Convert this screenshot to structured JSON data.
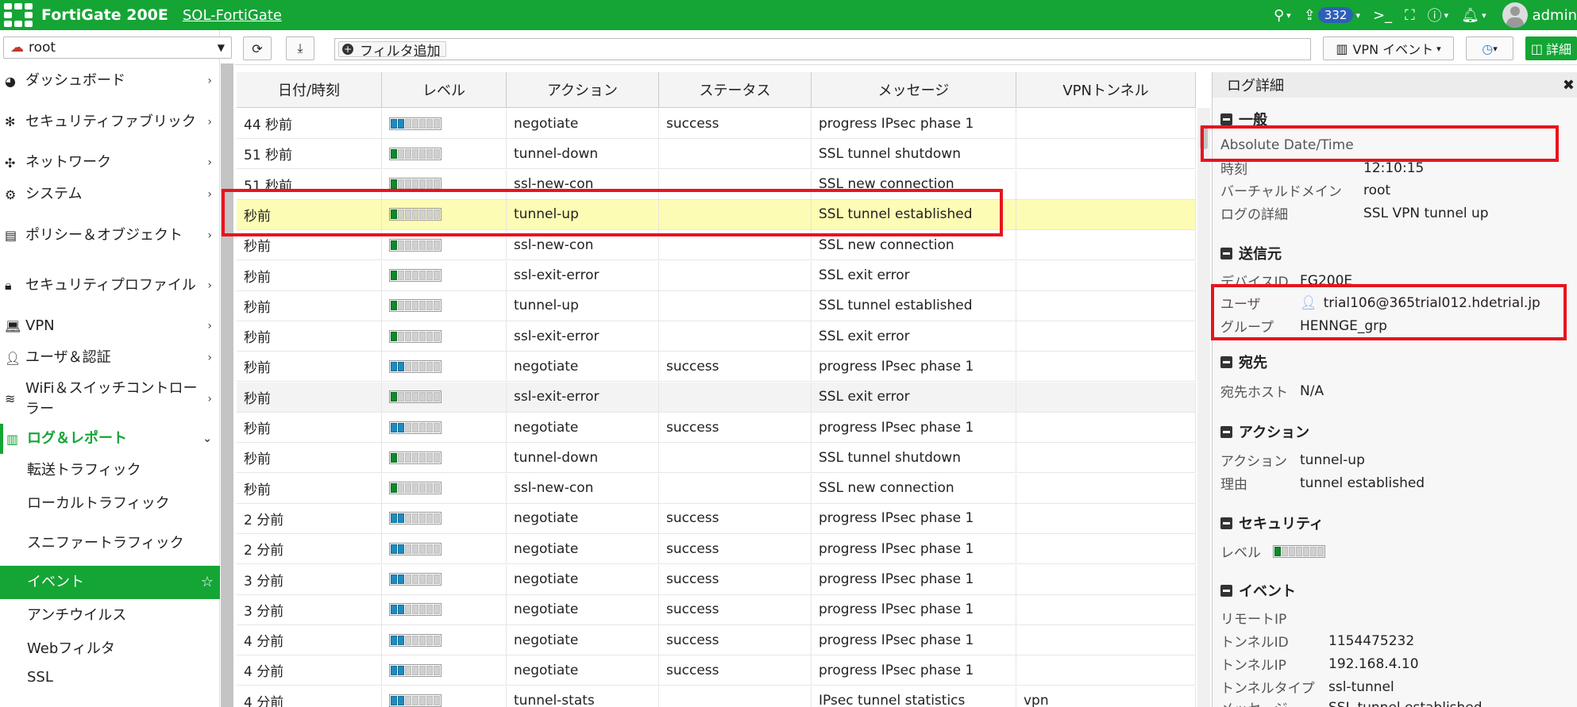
{
  "topbar": {
    "product": "FortiGate 200E",
    "hostname": "SOL-FortiGate",
    "notifications": "332",
    "username": "admin",
    "icons": [
      "search-icon",
      "upload-icon",
      "cli-icon",
      "fullscreen-icon",
      "help-icon",
      "bell-icon",
      "user-icon"
    ]
  },
  "sidebar": {
    "vdom": "root",
    "menu": [
      {
        "icon": "dashboard-icon",
        "label": "ダッシュボード",
        "h": 40
      },
      {
        "icon": "fabric-icon",
        "label": "セキュリティファブリック",
        "h": 63
      },
      {
        "icon": "network-icon",
        "label": "ネットワーク",
        "h": 40
      },
      {
        "icon": "gear-icon",
        "label": "システム",
        "h": 40
      },
      {
        "icon": "policy-icon",
        "label": "ポリシー＆オブジェクト",
        "h": 63
      },
      {
        "icon": "lock-icon",
        "label": "セキュリティプロファイル",
        "h": 63
      },
      {
        "icon": "laptop-icon",
        "label": "VPN",
        "h": 40
      },
      {
        "icon": "user-icon",
        "label": "ユーザ＆認証",
        "h": 40
      },
      {
        "icon": "wifi-icon",
        "label": "WiFi＆スイッチコントローラー",
        "h": 63
      }
    ],
    "active_section": {
      "icon": "chart-icon",
      "label": "ログ＆レポート"
    },
    "submenu": [
      "転送トラフィック",
      "ローカルトラフィック",
      "スニファートラフィック",
      "イベント",
      "アンチウイルス",
      "Webフィルタ",
      "SSL"
    ]
  },
  "toolbar": {
    "filter_label": "フィルタ追加",
    "vpn_events": "VPN イベント",
    "details": "詳細"
  },
  "grid": {
    "columns": [
      "日付/時刻",
      "レベル",
      "アクション",
      "ステータス",
      "メッセージ",
      "VPNトンネル"
    ],
    "rows": [
      {
        "time": "44 秒前",
        "level": "blue2",
        "action": "negotiate",
        "status": "success",
        "message": "progress IPsec phase 1",
        "vpn": ""
      },
      {
        "time": "51 秒前",
        "level": "green1",
        "action": "tunnel-down",
        "status": "",
        "message": "SSL tunnel shutdown",
        "vpn": ""
      },
      {
        "time": "51 秒前",
        "level": "green1",
        "action": "ssl-new-con",
        "status": "",
        "message": "SSL new connection",
        "vpn": ""
      },
      {
        "time": "秒前",
        "level": "green1",
        "action": "tunnel-up",
        "status": "",
        "message": "SSL tunnel established",
        "vpn": ""
      },
      {
        "time": "秒前",
        "level": "green1",
        "action": "ssl-new-con",
        "status": "",
        "message": "SSL new connection",
        "vpn": ""
      },
      {
        "time": "秒前",
        "level": "green1",
        "action": "ssl-exit-error",
        "status": "",
        "message": "SSL exit error",
        "vpn": ""
      },
      {
        "time": "秒前",
        "level": "green1",
        "action": "tunnel-up",
        "status": "",
        "message": "SSL tunnel established",
        "vpn": ""
      },
      {
        "time": "秒前",
        "level": "green1",
        "action": "ssl-exit-error",
        "status": "",
        "message": "SSL exit error",
        "vpn": ""
      },
      {
        "time": "秒前",
        "level": "blue2",
        "action": "negotiate",
        "status": "success",
        "message": "progress IPsec phase 1",
        "vpn": ""
      },
      {
        "time": "秒前",
        "level": "green1",
        "action": "ssl-exit-error",
        "status": "",
        "message": "SSL exit error",
        "vpn": ""
      },
      {
        "time": "秒前",
        "level": "blue2",
        "action": "negotiate",
        "status": "success",
        "message": "progress IPsec phase 1",
        "vpn": ""
      },
      {
        "time": "秒前",
        "level": "green1",
        "action": "tunnel-down",
        "status": "",
        "message": "SSL tunnel shutdown",
        "vpn": ""
      },
      {
        "time": "秒前",
        "level": "green1",
        "action": "ssl-new-con",
        "status": "",
        "message": "SSL new connection",
        "vpn": ""
      },
      {
        "time": "2 分前",
        "level": "blue2",
        "action": "negotiate",
        "status": "success",
        "message": "progress IPsec phase 1",
        "vpn": ""
      },
      {
        "time": "2 分前",
        "level": "blue2",
        "action": "negotiate",
        "status": "success",
        "message": "progress IPsec phase 1",
        "vpn": ""
      },
      {
        "time": "3 分前",
        "level": "blue2",
        "action": "negotiate",
        "status": "success",
        "message": "progress IPsec phase 1",
        "vpn": ""
      },
      {
        "time": "3 分前",
        "level": "blue2",
        "action": "negotiate",
        "status": "success",
        "message": "progress IPsec phase 1",
        "vpn": ""
      },
      {
        "time": "4 分前",
        "level": "blue2",
        "action": "negotiate",
        "status": "success",
        "message": "progress IPsec phase 1",
        "vpn": ""
      },
      {
        "time": "4 分前",
        "level": "blue2",
        "action": "negotiate",
        "status": "success",
        "message": "progress IPsec phase 1",
        "vpn": ""
      },
      {
        "time": "4 分前",
        "level": "blue2",
        "action": "tunnel-stats",
        "status": "",
        "message": "IPsec tunnel statistics",
        "vpn": "vpn"
      }
    ]
  },
  "panel": {
    "title": "ログ詳細",
    "general": {
      "title": "一般",
      "absolute": "Absolute Date/Time",
      "time_k": "時刻",
      "time_v": "12:10:15",
      "vdom_k": "バーチャルドメイン",
      "vdom_v": "root",
      "logdesc_k": "ログの詳細",
      "logdesc_v": "SSL VPN tunnel up"
    },
    "source": {
      "title": "送信元",
      "device_k": "デバイスID",
      "device_v": "FG200E",
      "user_k": "ユーザ",
      "user_v": "trial106@365trial012.hdetrial.jp",
      "group_k": "グループ",
      "group_v": "HENNGE_grp"
    },
    "destination": {
      "title": "宛先",
      "host_k": "宛先ホスト",
      "host_v": "N/A"
    },
    "action": {
      "title": "アクション",
      "action_k": "アクション",
      "action_v": "tunnel-up",
      "reason_k": "理由",
      "reason_v": "tunnel established"
    },
    "security": {
      "title": "セキュリティ",
      "level_k": "レベル"
    },
    "event": {
      "title": "イベント",
      "remoteip_k": "リモートIP",
      "remoteip_v": "",
      "tunnelid_k": "トンネルID",
      "tunnelid_v": "1154475232",
      "tunnelip_k": "トンネルIP",
      "tunnelip_v": "192.168.4.10",
      "tunneltype_k": "トンネルタイプ",
      "tunneltype_v": "ssl-tunnel",
      "msg_k": "メッセージ",
      "msg_v": "SSL tunnel established"
    }
  },
  "colors": {
    "brand": "#14a535",
    "highlight_row": "#fdfcb4",
    "annotation": "#e8141e",
    "badge": "#2e5fb7"
  }
}
